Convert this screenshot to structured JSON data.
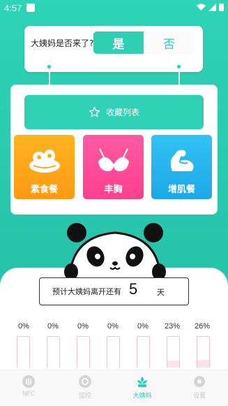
{
  "status_bar": {
    "time": "4:57"
  },
  "question": {
    "label": "大姨妈是否来了?",
    "yes": "是",
    "no": "否",
    "selected": "是"
  },
  "favorites": {
    "label": "收藏列表",
    "icon": "star-icon"
  },
  "tiles": [
    {
      "label": "素食餐",
      "icon": "food-icon",
      "color": "#ffa817"
    },
    {
      "label": "丰胸",
      "icon": "bra-icon",
      "color": "#ff4d98"
    },
    {
      "label": "增肌餐",
      "icon": "muscle-arm-icon",
      "color": "#27b6ee"
    }
  ],
  "countdown": {
    "prefix": "预计大姨妈离开还有",
    "value": "5",
    "unit": "天"
  },
  "daily_percent": [
    "0%",
    "0%",
    "0%",
    "0%",
    "0%",
    "23%",
    "26%"
  ],
  "daily_fill": [
    0,
    0,
    0,
    0,
    0,
    0.23,
    0.26
  ],
  "nav": [
    {
      "label": "NFC",
      "icon": "nfc-icon",
      "active": false
    },
    {
      "label": "监控",
      "icon": "monitor-icon",
      "active": false
    },
    {
      "label": "大姨妈",
      "icon": "flower-icon",
      "active": true
    },
    {
      "label": "设置",
      "icon": "gear-icon",
      "active": false
    }
  ],
  "colors": {
    "accent": "#2ecfb3",
    "background": "#2fd3b5"
  }
}
